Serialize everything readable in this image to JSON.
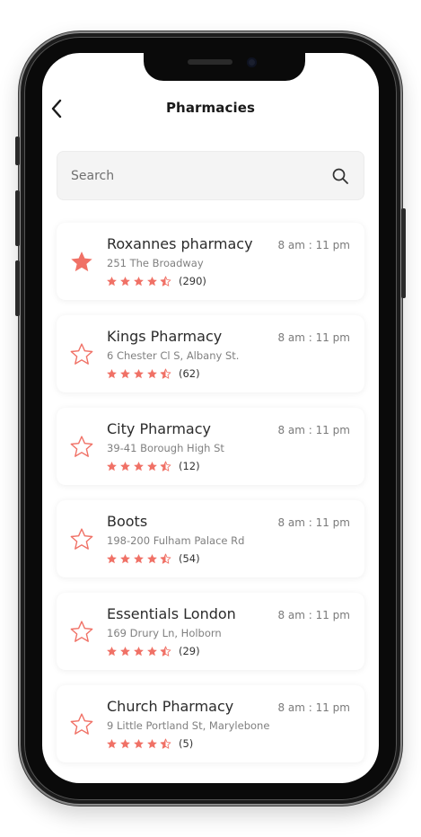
{
  "header": {
    "title": "Pharmacies",
    "back_icon": "chevron-left-icon"
  },
  "search": {
    "placeholder": "Search",
    "value": "",
    "icon": "search-icon"
  },
  "colors": {
    "accent": "#f07166",
    "text_primary": "#2b2b2b",
    "text_secondary": "#808080",
    "card_bg": "#ffffff",
    "search_bg": "#f4f4f4"
  },
  "pharmacies": [
    {
      "name": "Roxannes pharmacy",
      "address": "251 The Broadway",
      "hours": "8 am : 11 pm",
      "rating": 4.5,
      "reviews": "(290)",
      "favorite": true
    },
    {
      "name": "Kings Pharmacy",
      "address": "6 Chester Cl S, Albany St.",
      "hours": "8 am : 11 pm",
      "rating": 4.5,
      "reviews": "(62)",
      "favorite": false
    },
    {
      "name": "City Pharmacy",
      "address": "39-41 Borough High St",
      "hours": "8 am : 11 pm",
      "rating": 4.5,
      "reviews": "(12)",
      "favorite": false
    },
    {
      "name": "Boots",
      "address": "198-200 Fulham Palace Rd",
      "hours": "8 am : 11 pm",
      "rating": 4.5,
      "reviews": "(54)",
      "favorite": false
    },
    {
      "name": "Essentials London",
      "address": "169 Drury Ln, Holborn",
      "hours": "8 am : 11 pm",
      "rating": 4.5,
      "reviews": "(29)",
      "favorite": false
    },
    {
      "name": "Church Pharmacy",
      "address": "9 Little Portland St, Marylebone",
      "hours": "8 am : 11 pm",
      "rating": 4.5,
      "reviews": "(5)",
      "favorite": false
    }
  ]
}
